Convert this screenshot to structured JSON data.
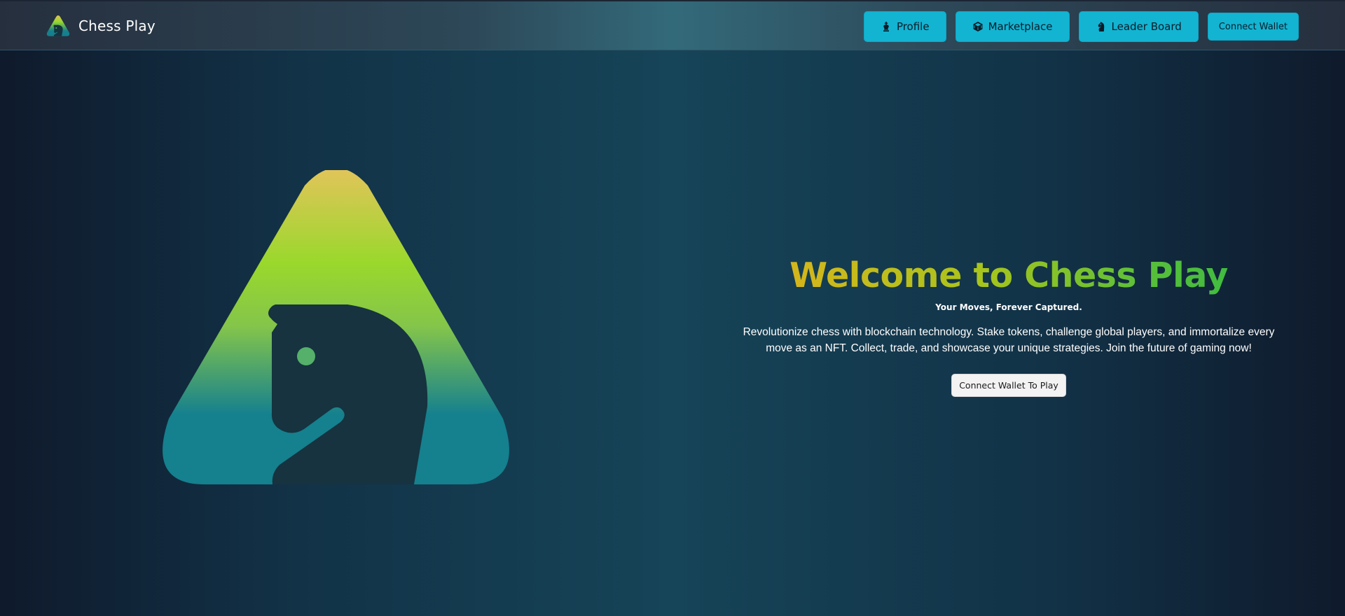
{
  "nav": {
    "brand_name": "Chess Play",
    "profile_label": "Profile",
    "marketplace_label": "Marketplace",
    "leaderboard_label": "Leader Board",
    "connect_wallet_label": "Connect Wallet"
  },
  "hero": {
    "title": "Welcome to Chess Play",
    "subtitle": "Your Moves, Forever Captured.",
    "description": "Revolutionize chess with blockchain technology. Stake tokens, challenge global players, and immortalize every move as an NFT. Collect, trade, and showcase your unique strategies. Join the future of gaming now!",
    "cta_label": "Connect Wallet To Play"
  },
  "icons": {
    "profile": "king-icon",
    "marketplace": "cube-icon",
    "leaderboard": "knight-icon",
    "brand": "chess-play-logo-icon",
    "hero": "chess-play-hero-logo"
  },
  "colors": {
    "nav_button_bg": "#12b4d2",
    "title_gradient_start": "#e2b11b",
    "title_gradient_end": "#2fb845",
    "logo_gradient_top": "#e0c058",
    "logo_gradient_mid": "#9ad82c",
    "logo_gradient_bottom": "#15808e",
    "background": "#164458"
  }
}
